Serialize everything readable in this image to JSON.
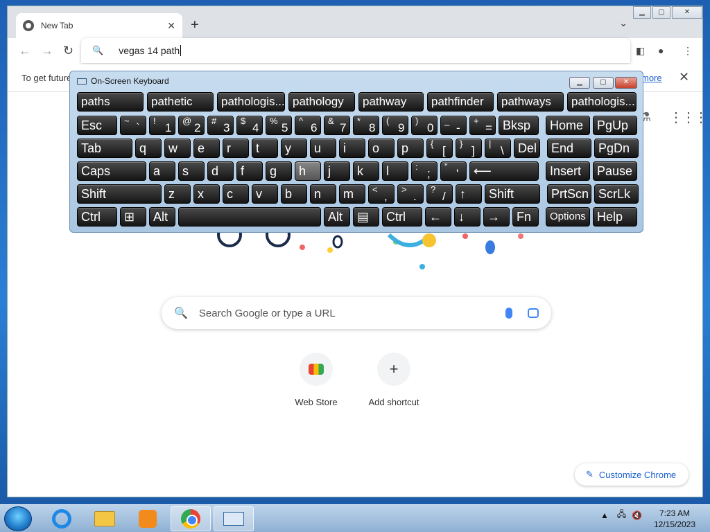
{
  "chrome": {
    "tab_title": "New Tab",
    "omnibox_text": "vegas 14 path",
    "infobar_text": "To get future",
    "infobar_link": "more",
    "search_placeholder": "Search Google or type a URL",
    "shortcuts": [
      {
        "label": "Web Store"
      },
      {
        "label": "Add shortcut"
      }
    ],
    "customize_label": "Customize Chrome"
  },
  "osk": {
    "title": "On-Screen Keyboard",
    "predictions": [
      "paths",
      "pathetic",
      "pathologis...",
      "pathology",
      "pathway",
      "pathfinder",
      "pathways",
      "pathologis..."
    ],
    "row1": [
      {
        "label": "Esc"
      },
      {
        "sup": "~",
        "main": "`"
      },
      {
        "sup": "!",
        "main": "1"
      },
      {
        "sup": "@",
        "main": "2"
      },
      {
        "sup": "#",
        "main": "3"
      },
      {
        "sup": "$",
        "main": "4"
      },
      {
        "sup": "%",
        "main": "5"
      },
      {
        "sup": "^",
        "main": "6"
      },
      {
        "sup": "&",
        "main": "7"
      },
      {
        "sup": "*",
        "main": "8"
      },
      {
        "sup": "(",
        "main": "9"
      },
      {
        "sup": ")",
        "main": "0"
      },
      {
        "sup": "_",
        "main": "-"
      },
      {
        "sup": "+",
        "main": "="
      },
      {
        "label": "Bksp"
      },
      {
        "label": "Home"
      },
      {
        "label": "PgUp"
      }
    ],
    "row2": [
      {
        "label": "Tab"
      },
      {
        "label": "q"
      },
      {
        "label": "w"
      },
      {
        "label": "e"
      },
      {
        "label": "r"
      },
      {
        "label": "t"
      },
      {
        "label": "y"
      },
      {
        "label": "u"
      },
      {
        "label": "i"
      },
      {
        "label": "o"
      },
      {
        "label": "p"
      },
      {
        "sup": "{",
        "main": "["
      },
      {
        "sup": "}",
        "main": "]"
      },
      {
        "sup": "|",
        "main": "\\"
      },
      {
        "label": "Del"
      },
      {
        "label": "End"
      },
      {
        "label": "PgDn"
      }
    ],
    "row3": [
      {
        "label": "Caps"
      },
      {
        "label": "a"
      },
      {
        "label": "s"
      },
      {
        "label": "d"
      },
      {
        "label": "f"
      },
      {
        "label": "g"
      },
      {
        "label": "h"
      },
      {
        "label": "j"
      },
      {
        "label": "k"
      },
      {
        "label": "l"
      },
      {
        "sup": ":",
        "main": ";"
      },
      {
        "sup": "\"",
        "main": "'"
      },
      {
        "label": "⟵"
      },
      {
        "label": "Insert"
      },
      {
        "label": "Pause"
      }
    ],
    "row4": [
      {
        "label": "Shift"
      },
      {
        "label": "z"
      },
      {
        "label": "x"
      },
      {
        "label": "c"
      },
      {
        "label": "v"
      },
      {
        "label": "b"
      },
      {
        "label": "n"
      },
      {
        "label": "m"
      },
      {
        "sup": "<",
        "main": ","
      },
      {
        "sup": ">",
        "main": "."
      },
      {
        "sup": "?",
        "main": "/"
      },
      {
        "label": "↑"
      },
      {
        "label": "Shift"
      },
      {
        "label": "PrtScn"
      },
      {
        "label": "ScrLk"
      }
    ],
    "row5": [
      {
        "label": "Ctrl"
      },
      {
        "label": "⊞"
      },
      {
        "label": "Alt"
      },
      {
        "label": ""
      },
      {
        "label": "Alt"
      },
      {
        "label": "▤"
      },
      {
        "label": "Ctrl"
      },
      {
        "label": "←"
      },
      {
        "label": "↓"
      },
      {
        "label": "→"
      },
      {
        "label": "Fn"
      },
      {
        "label": "Options"
      },
      {
        "label": "Help"
      }
    ]
  },
  "taskbar": {
    "time": "7:23 AM",
    "date": "12/15/2023"
  }
}
